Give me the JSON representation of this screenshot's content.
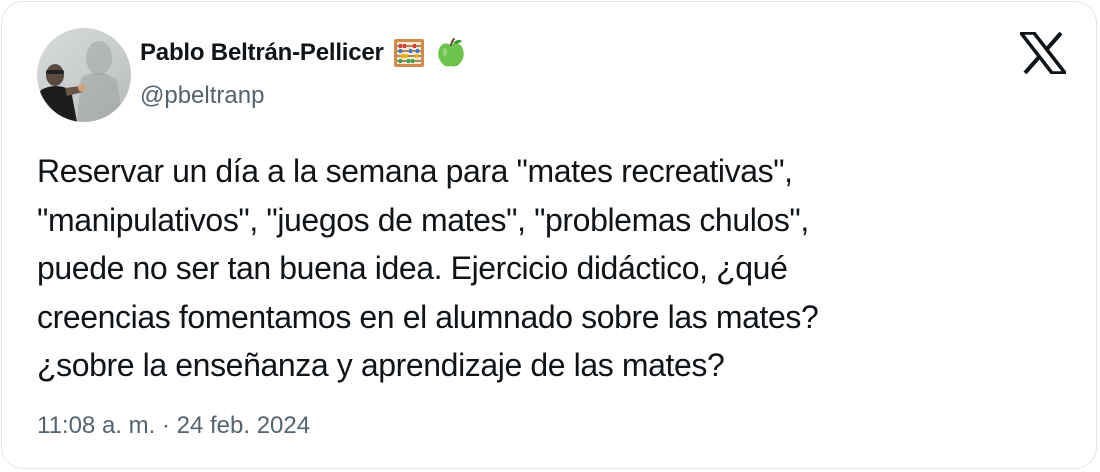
{
  "author": {
    "display_name": "Pablo Beltrán-Pellicer",
    "handle": "@pbeltranp",
    "badges": [
      "abacus-emoji",
      "green-apple-emoji"
    ]
  },
  "tweet": {
    "lines": [
      "Reservar un día a la semana para \"mates recreativas\",",
      "\"manipulativos\", \"juegos de mates\", \"problemas chulos\",",
      "puede no ser tan buena idea. Ejercicio didáctico, ¿qué",
      "creencias fomentamos en el alumnado sobre las mates?",
      "¿sobre la enseñanza y aprendizaje de las mates?"
    ]
  },
  "meta": {
    "time": "11:08 a. m.",
    "separator": "·",
    "date": "24 feb. 2024"
  },
  "platform": {
    "logo": "x-logo-icon"
  },
  "colors": {
    "text_primary": "#0f1419",
    "text_secondary": "#536471",
    "border": "#e3e6e9"
  }
}
